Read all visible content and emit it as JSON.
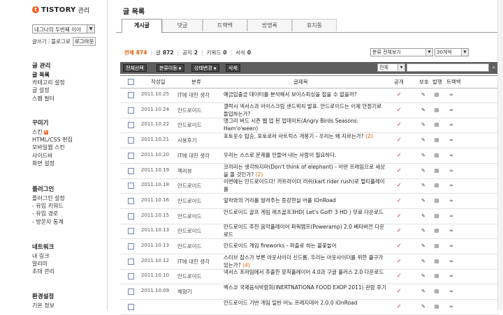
{
  "sidebar": {
    "logo_mark": "t",
    "brand": "TISTORY",
    "brand_suffix": "관리",
    "blog_selector": "네그나의 두번째 이야",
    "links": {
      "write": "글쓰기",
      "blog": "블로그로",
      "logout": "로그아웃"
    },
    "sections": [
      {
        "title": "글 관리",
        "items": [
          "글 목록",
          "카테고리 설정",
          "글 설정",
          "스팸 필터"
        ]
      },
      {
        "title": "꾸미기",
        "items": [
          "스킨",
          "HTML/CSS 편집",
          "모바일웹 스킨",
          "사이드바",
          "화면 설정"
        ]
      },
      {
        "title": "플러그인",
        "items": [
          "플러그인 설정",
          "- 유입 키워드",
          "- 유입 경로",
          "- 방문자 통계"
        ]
      },
      {
        "title": "네트워크",
        "items": [
          "내 링크",
          "알리미",
          "초대 관리"
        ]
      },
      {
        "title": "환경설정",
        "items": [
          "기본 정보"
        ]
      }
    ],
    "new_badge": "N"
  },
  "main": {
    "page_title": "글 목록",
    "tabs": [
      "게시글",
      "댓글",
      "트랙백",
      "방명록",
      "휴지통"
    ],
    "summary": {
      "all_label": "전체",
      "all_count": "874",
      "post_label": "글",
      "post_count": "872",
      "notice_label": "공지",
      "notice_count": "2",
      "keyword_label": "키워드",
      "keyword_count": "0",
      "form_label": "서식",
      "form_count": "0"
    },
    "category_filter": "분류 전체보기",
    "page_size": "30개씩",
    "toolbar": {
      "select_all": "전체선택",
      "move_category": "분류이동",
      "change_state": "상태변경",
      "delete": "삭제",
      "search_scope": "전체",
      "search_placeholder": ""
    },
    "columns": {
      "date": "작성일",
      "category": "분류",
      "title": "글제목",
      "public": "공개",
      "protect": "보호",
      "publish": "발행",
      "trackback": "트랙백"
    },
    "rows": [
      {
        "date": "2011.10.25",
        "category": "IT에 대한 생각",
        "title": "예금입출금 데이터를 분석해서 보이스피싱을 잡을 수 없을까?",
        "comments": ""
      },
      {
        "date": "2011.10.24",
        "category": "안드로이드",
        "title": "갤럭시 넥서스과 아이스크림 샌드위치 발표. 안드로이드는 이제 안정기로 들입하는가?",
        "comments": ""
      },
      {
        "date": "2011.10.22",
        "category": "안드로이드",
        "title": "앵그리 버드 시즌 웹 업 된 업데이트(Angry Birds Seasons: Ham'o'ween)",
        "comments": ""
      },
      {
        "date": "2011.10.21",
        "category": "사용후기",
        "title": "포토웃수 탑승, 포토로라 아트릭스 개봉기 - 우리는 왜 지르는가? ",
        "comments": "(2)"
      },
      {
        "date": "2011.10.20",
        "category": "IT에 대한 생각",
        "title": "우리는 스스로 문제를 만들어 내는 사람이 필요하다.",
        "comments": ""
      },
      {
        "date": "2011.10.19",
        "category": "책리뷰",
        "title": "코끼리는 생각하지마(Don't think of elephant) - 어떤 프레임으로 세상을 볼 것인가? ",
        "comments": "(2)"
      },
      {
        "date": "2011.10.18",
        "category": "안드로이드",
        "title": "이번에는 안드로이드다! 카트라이더 러쉬(kart rider rush)로 멀티플레이를",
        "comments": ""
      },
      {
        "date": "2011.10.16",
        "category": "안드로이드",
        "title": "앞차와의 거리를 알려주는 증강현실 어플 iOnRoad",
        "comments": ""
      },
      {
        "date": "2011.10.15",
        "category": "안드로이드",
        "title": "안드로이드 골프 게임 레츠골프3HD( Let's Golf! 3 HD ) 무료 다운로드",
        "comments": ""
      },
      {
        "date": "2011.10.13",
        "category": "안드로이드",
        "title": "안드로이드 추천 음악플레이어 파워앰프(Poweramp) 2.0 베타버전 다운로드",
        "comments": ""
      },
      {
        "date": "2011.10.13",
        "category": "안드로이드",
        "title": "안드로이드 게임 fireworks - 퍼즐로 하는 불꽃놀이",
        "comments": ""
      },
      {
        "date": "2011.10.12",
        "category": "IT에 대한 생각",
        "title": "스티브 잡스가 부른 아웃사이더 신드롬. 우리는 아웃사이더를 위한 플구가 있는가? ",
        "comments": "(4)"
      },
      {
        "date": "2011.10.10",
        "category": "안드로이드",
        "title": "넥서스 프라임에서 추출한 뮤직플레이어 4.0과 구글 플러스 2.0 다운로드",
        "comments": ""
      },
      {
        "date": "2011.10.09",
        "category": "체험기",
        "title": "벡스코 국제음식박람회(INERTNATIONA FOOD EXOP 2011) 관람 후기",
        "comments": ""
      },
      {
        "date": "",
        "category": "",
        "title": "안드로이드 기반 게임 일반 어노 프레지데어 2.0.0 iOnRoad",
        "comments": ""
      }
    ]
  }
}
